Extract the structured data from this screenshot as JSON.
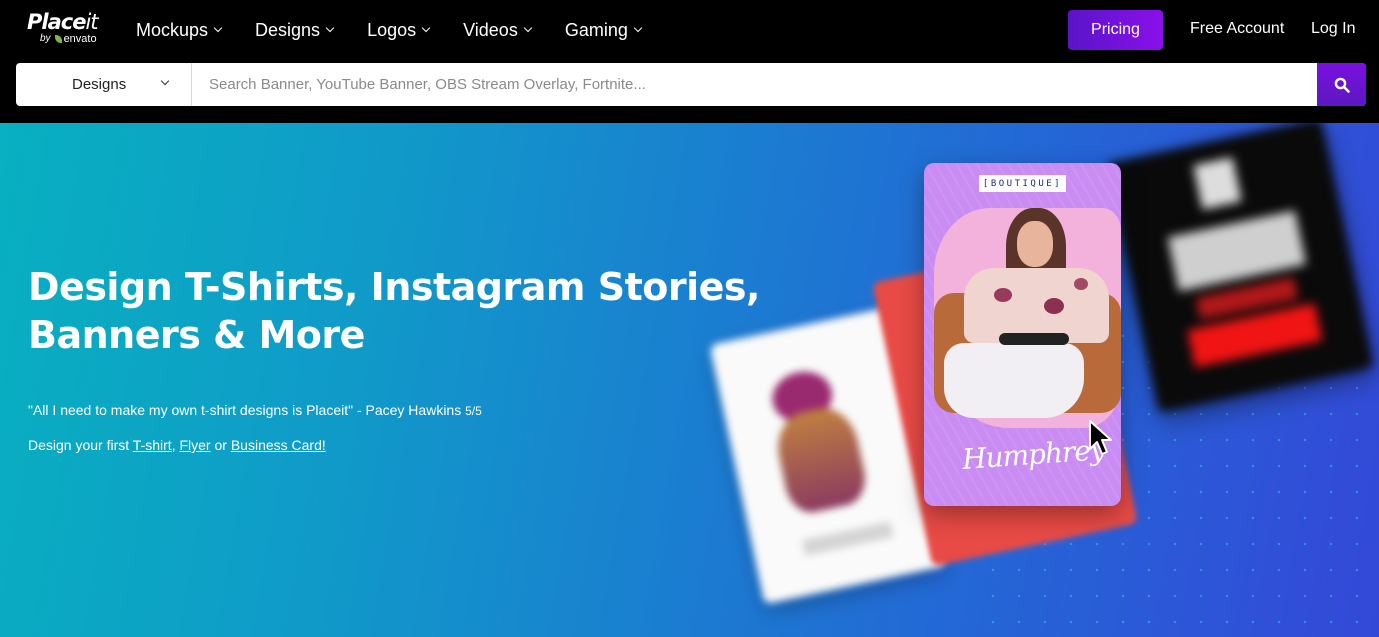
{
  "brand": {
    "name_bold": "Place",
    "name_light": "it",
    "by": "by",
    "parent": "envato"
  },
  "nav": {
    "items": [
      {
        "label": "Mockups",
        "icon": "chevron-down-icon"
      },
      {
        "label": "Designs",
        "icon": "chevron-down-icon"
      },
      {
        "label": "Logos",
        "icon": "chevron-down-icon"
      },
      {
        "label": "Videos",
        "icon": "chevron-down-icon"
      },
      {
        "label": "Gaming",
        "icon": "chevron-down-icon"
      }
    ],
    "pricing_label": "Pricing",
    "free_account_label": "Free Account",
    "login_label": "Log In"
  },
  "search": {
    "category_selected": "Designs",
    "placeholder": "Search Banner, YouTube Banner, OBS Stream Overlay, Fortnite...",
    "value": "",
    "button_icon": "search-icon"
  },
  "hero": {
    "title_line1": "Design T-Shirts, Instagram Stories,",
    "title_line2": "Banners & More",
    "quote": "\"All I need to make my own t-shirt designs is Placeit\" - Pacey Hawkins",
    "rating": "5/5",
    "cta_prefix": "Design your first",
    "cta_link1": "T-shirt",
    "cta_sep1": ",",
    "cta_link2": "Flyer",
    "cta_sep2": "or",
    "cta_link3": "Business Card!"
  },
  "collage": {
    "main_card_tag": "[BOUTIQUE]",
    "main_card_signature": "Humphrey"
  },
  "colors": {
    "accent_purple": "#7a10e0",
    "hero_start": "#08b0c0",
    "hero_end": "#3448d8",
    "envato_green": "#82b541"
  }
}
